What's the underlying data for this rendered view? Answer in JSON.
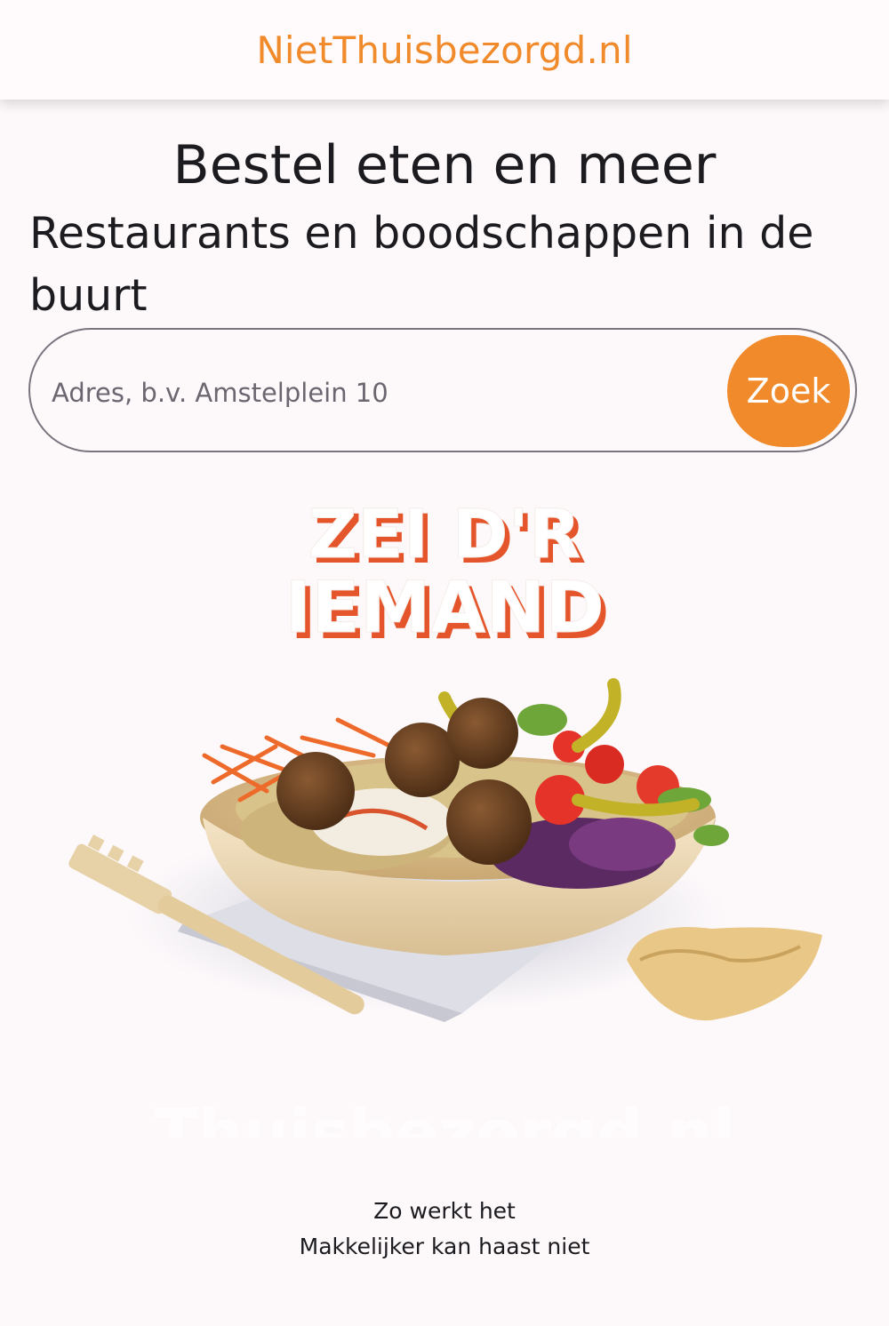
{
  "header": {
    "brand": "NietThuisbezorgd.nl"
  },
  "main": {
    "title": "Bestel eten en meer",
    "subtitle": "Restaurants en boodschappen in de buurt",
    "search": {
      "placeholder": "Adres, b.v. Amstelplein 10",
      "value": "",
      "button_label": "Zoek"
    },
    "hero": {
      "slogan_line1": "ZEI D'R",
      "slogan_line2": "IEMAND",
      "watermark": "Thuisbezorgd.nl"
    }
  },
  "footer": {
    "how_it_works": "Zo werkt het",
    "tagline": "Makkelijker kan haast niet"
  },
  "colors": {
    "accent": "#f08a2a",
    "background": "#fdf9fb",
    "text": "#1c1b1f",
    "outline": "#79747e"
  }
}
